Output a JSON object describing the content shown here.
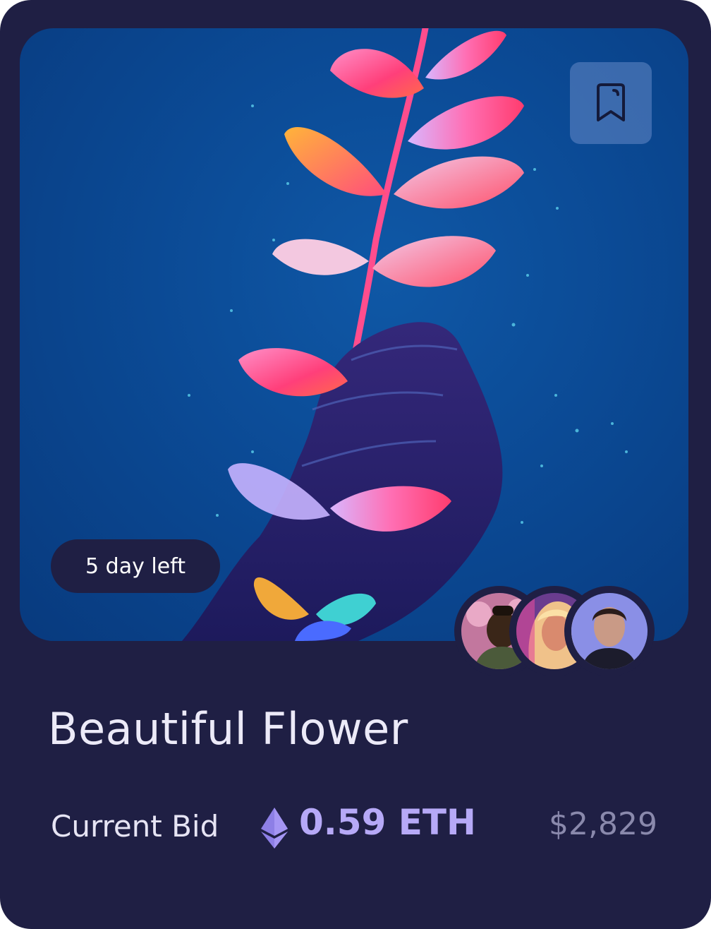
{
  "card": {
    "time_left": "5 day left",
    "title": "Beautiful Flower",
    "bid_label": "Current Bid",
    "bid_amount": "0.59 ETH",
    "bid_usd": "$2,829"
  },
  "icons": {
    "bookmark": "bookmark-icon",
    "currency": "ethereum-icon"
  },
  "avatars": [
    {
      "name": "avatar-1"
    },
    {
      "name": "avatar-2"
    },
    {
      "name": "avatar-3"
    }
  ],
  "colors": {
    "card_background": "#1f1f44",
    "artwork_background": "#0b4a95",
    "accent": "#b6a9f7",
    "muted_text": "#8a89ac"
  }
}
